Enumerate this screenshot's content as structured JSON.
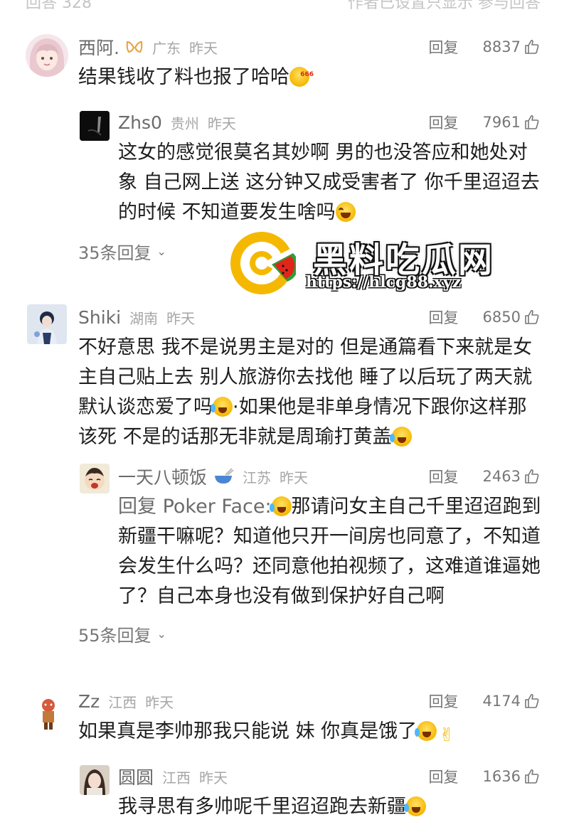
{
  "top_partial": {
    "left": "回答 328",
    "right": "作者已设置只显示 参与回答"
  },
  "reply_label": "回复",
  "comments": [
    {
      "username": "西阿.",
      "region": "广东",
      "time": "昨天",
      "likes": "8837",
      "text": "结果钱收了料也报了哈哈",
      "replies": [
        {
          "username": "Zhs0",
          "region": "贵州",
          "time": "昨天",
          "likes": "7961",
          "text": "这女的感觉很莫名其妙啊 男的也没答应和她处对象 自己网上送 这分钟又成受害者了 你千里迢迢去的时候 不知道要发生啥吗"
        }
      ],
      "more_replies": "35条回复"
    },
    {
      "username": "Shiki",
      "region": "湖南",
      "time": "昨天",
      "likes": "6850",
      "text_part1": "不好意思 我不是说男主是对的 但是通篇看下来就是女主自己贴上去 别人旅游你去找他 睡了以后玩了两天就默认谈恋爱了吗",
      "text_part2": "·如果他是非单身情况下跟你这样那该死 不是的话那无非就是周瑜打黄盖",
      "replies": [
        {
          "username": "一天八顿饭",
          "region": "江苏",
          "time": "昨天",
          "likes": "2463",
          "reply_to": "回复 Poker Face:",
          "text": "那请问女主自己千里迢迢跑到新疆干嘛呢？知道他只开一间房也同意了，不知道会发生什么吗？还同意他拍视频了，这难道谁逼她了？自己本身也没有做到保护好自己啊"
        }
      ],
      "more_replies": "55条回复"
    },
    {
      "username": "Zz",
      "region": "江西",
      "time": "昨天",
      "likes": "4174",
      "text": "如果真是李帅那我只能说 妹 你真是饿了",
      "replies": [
        {
          "username": "圆圆",
          "region": "江西",
          "time": "昨天",
          "likes": "1636",
          "text": "我寻思有多帅呢千里迢迢跑去新疆"
        }
      ]
    }
  ],
  "watermark": {
    "title": "黑料吃瓜网",
    "url": "https://hlcg88.xyz"
  },
  "colors": {
    "username": "#6b6b6b",
    "meta": "#a6a6a6",
    "text": "#1e1e1e",
    "logo_yellow": "#f5b800",
    "logo_green": "#2e9e3a",
    "logo_red": "#e0261a"
  }
}
